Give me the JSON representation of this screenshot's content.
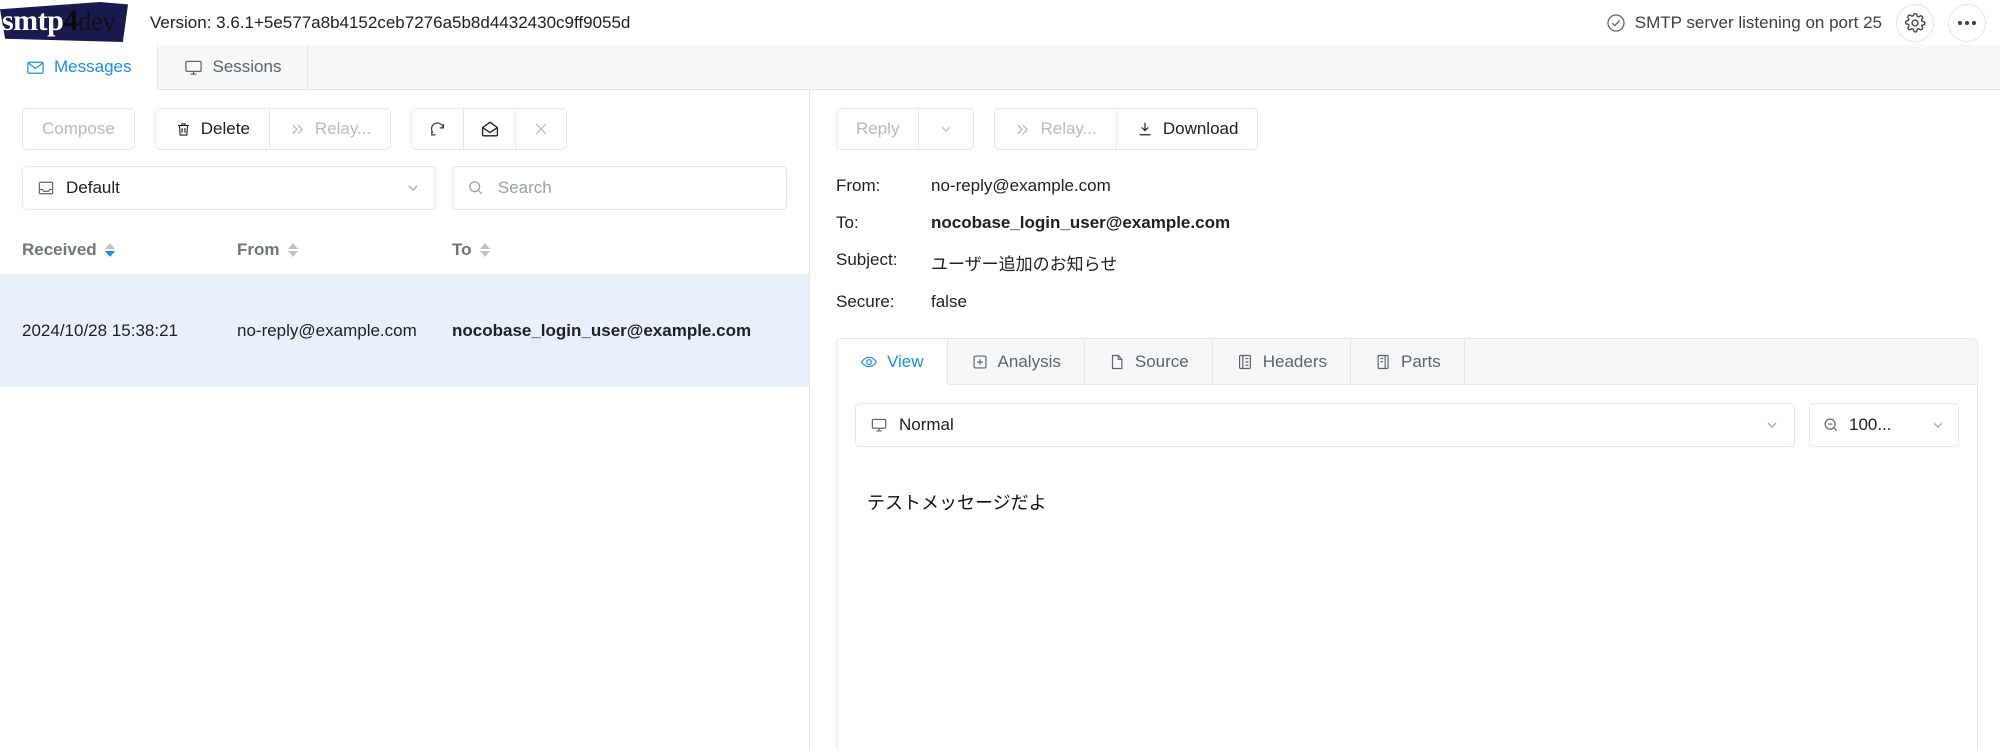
{
  "app": {
    "logo_smtp": "smtp",
    "logo_four": "4",
    "logo_dev": "dev",
    "version": "Version: 3.6.1+5e577a8b4152ceb7276a5b8d4432430c9ff9055d",
    "server_status": "SMTP server listening on port 25",
    "settings_icon": "gear-icon",
    "more_icon": "ellipsis-icon",
    "accent_color": "#1a8cf0",
    "selected_row_color": "#e9f0fc",
    "logo_background": "#1a1a4e"
  },
  "main_tabs": [
    {
      "label": "Messages",
      "icon": "envelope-icon",
      "active": true
    },
    {
      "label": "Sessions",
      "icon": "monitor-icon",
      "active": false
    }
  ],
  "message_toolbar": {
    "compose": "Compose",
    "delete": "Delete",
    "relay": "Relay...",
    "refresh_icon": "refresh-icon",
    "mark_read_icon": "open-envelope-icon",
    "close_icon": "close-icon"
  },
  "filters": {
    "mailbox_selected": "Default",
    "mailbox_icon": "inbox-icon",
    "search_value": "",
    "search_placeholder": "Search",
    "search_icon": "search-icon"
  },
  "message_table": {
    "columns": [
      {
        "label": "Received",
        "sorted": "desc"
      },
      {
        "label": "From",
        "sorted": "none"
      },
      {
        "label": "To",
        "sorted": "none"
      }
    ],
    "rows": [
      {
        "received": "2024/10/28 15:38:21",
        "from": "no-reply@example.com",
        "to": "nocobase_login_user@example.com",
        "selected": true
      }
    ]
  },
  "detail_toolbar": {
    "reply": "Reply",
    "reply_chevron": "chevron-down-icon",
    "relay": "Relay...",
    "download": "Download",
    "download_icon": "download-icon"
  },
  "message_headers": [
    {
      "label": "From:",
      "value": "no-reply@example.com",
      "bold": false
    },
    {
      "label": "To:",
      "value": "nocobase_login_user@example.com",
      "bold": true
    },
    {
      "label": "Subject:",
      "value": "ユーザー追加のお知らせ",
      "bold": false
    },
    {
      "label": "Secure:",
      "value": "false",
      "bold": false
    }
  ],
  "detail_tabs": [
    {
      "label": "View",
      "icon": "eye-icon",
      "active": true
    },
    {
      "label": "Analysis",
      "icon": "analysis-icon",
      "active": false
    },
    {
      "label": "Source",
      "icon": "file-icon",
      "active": false
    },
    {
      "label": "Headers",
      "icon": "list-icon",
      "active": false
    },
    {
      "label": "Parts",
      "icon": "parts-icon",
      "active": false
    }
  ],
  "viewer": {
    "mode": "Normal",
    "mode_icon": "monitor-icon",
    "zoom": "100...",
    "zoom_icon": "zoom-out-icon",
    "body": "テストメッセージだよ"
  }
}
